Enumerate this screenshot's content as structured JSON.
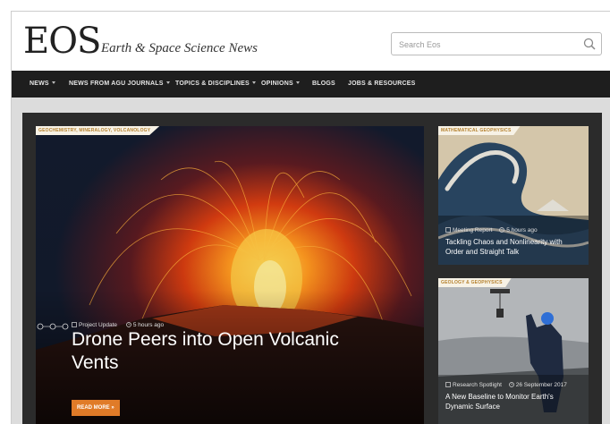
{
  "header": {
    "logo": "EOS",
    "tagline": "Earth & Space Science News",
    "search_placeholder": "Search Eos"
  },
  "nav": {
    "items": [
      {
        "label": "NEWS",
        "dropdown": true
      },
      {
        "label": "NEWS FROM AGU JOURNALS",
        "dropdown": true
      },
      {
        "label": "TOPICS & DISCIPLINES",
        "dropdown": true
      },
      {
        "label": "OPINIONS",
        "dropdown": true
      },
      {
        "label": "BLOGS",
        "dropdown": false
      },
      {
        "label": "JOBS & RESOURCES",
        "dropdown": false
      }
    ]
  },
  "hero": {
    "tag": "GEOCHEMISTRY, MINERALOGY, VOLCANOLOGY",
    "type": "Project Update",
    "time": "5 hours ago",
    "title": "Drone Peers into Open Volcanic Vents",
    "read_more": "READ MORE »"
  },
  "cards": [
    {
      "tag": "MATHEMATICAL GEOPHYSICS",
      "type": "Meeting Report",
      "time": "5 hours ago",
      "title": "Tackling Chaos and Nonlinearity with Order and Straight Talk"
    },
    {
      "tag": "GEOLOGY & GEOPHYSICS",
      "type": "Research Spotlight",
      "time": "26 September 2017",
      "title": "A New Baseline to Monitor Earth's Dynamic Surface"
    }
  ],
  "colors": {
    "nav_bg": "#1e1e1e",
    "accent": "#e07b28",
    "tag_text": "#b5812e"
  }
}
